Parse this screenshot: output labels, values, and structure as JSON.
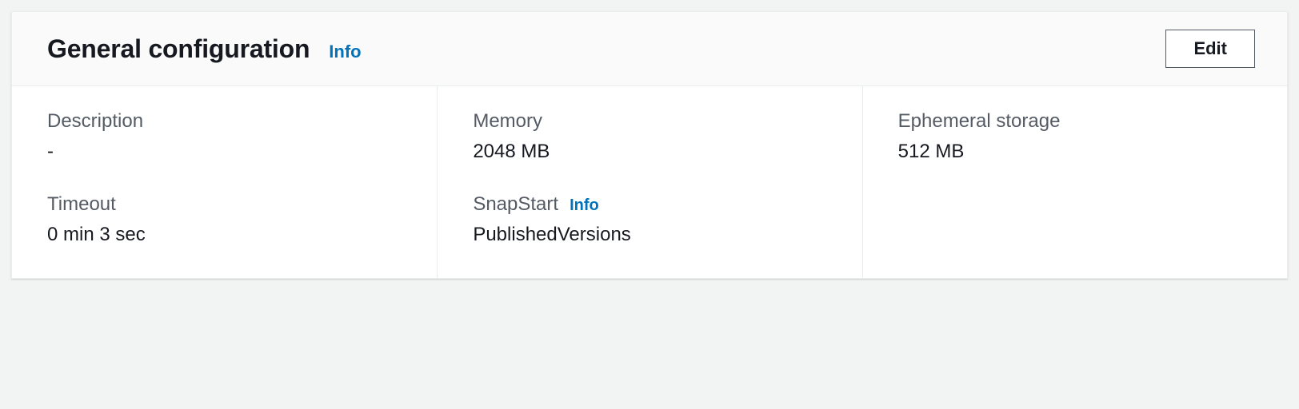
{
  "panel": {
    "title": "General configuration",
    "info_label": "Info",
    "edit_label": "Edit"
  },
  "fields": {
    "description": {
      "label": "Description",
      "value": "-"
    },
    "memory": {
      "label": "Memory",
      "value": "2048  MB"
    },
    "ephemeral_storage": {
      "label": "Ephemeral storage",
      "value": "512  MB"
    },
    "timeout": {
      "label": "Timeout",
      "value": "0  min   3  sec"
    },
    "snapstart": {
      "label": "SnapStart",
      "info_label": "Info",
      "value": "PublishedVersions"
    }
  }
}
